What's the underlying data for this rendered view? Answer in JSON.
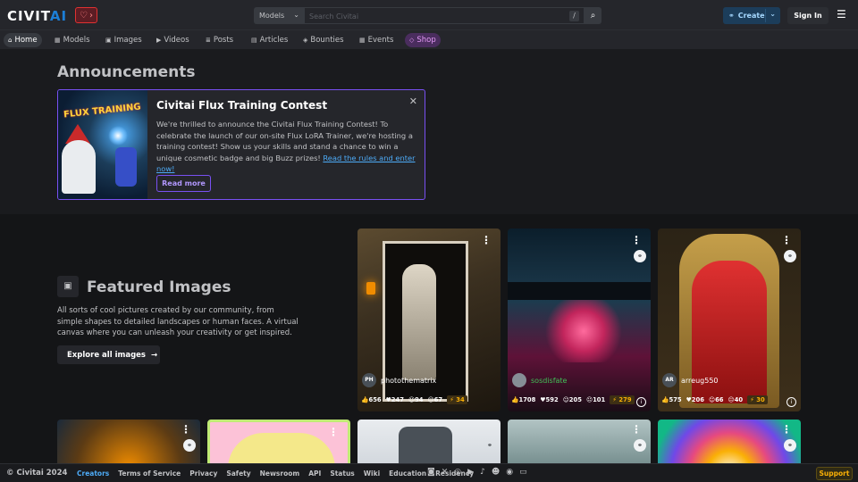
{
  "header": {
    "logo_main": "CIVIT",
    "logo_ai": "AI",
    "heart_chevron": "›",
    "search_type": "Models",
    "search_placeholder": "Search Civitai",
    "search_shortcut": "/",
    "create_label": "Create",
    "signin_label": "Sign In"
  },
  "nav": {
    "items": [
      {
        "label": "Home",
        "icon": "⌂"
      },
      {
        "label": "Models",
        "icon": "▦"
      },
      {
        "label": "Images",
        "icon": "▣"
      },
      {
        "label": "Videos",
        "icon": "▶"
      },
      {
        "label": "Posts",
        "icon": "≣"
      },
      {
        "label": "Articles",
        "icon": "▤"
      },
      {
        "label": "Bounties",
        "icon": "◈"
      },
      {
        "label": "Events",
        "icon": "▦"
      },
      {
        "label": "Shop",
        "icon": "◇"
      }
    ]
  },
  "announcements": {
    "title": "Announcements",
    "card": {
      "image_text": "FLUX TRAINING",
      "heading": "Civitai Flux Training Contest",
      "body": "We're thrilled to announce the Civitai Flux Training Contest! To celebrate the launch of our on-site Flux LoRA Trainer, we're hosting a training contest! Show us your skills and stand a chance to win a unique cosmetic badge and big Buzz prizes! ",
      "link": "Read the rules and enter now!",
      "button": "Read more"
    }
  },
  "featured": {
    "title": "Featured Images",
    "description": "All sorts of cool pictures created by our community, from simple shapes to detailed landscapes or human faces. A virtual canvas where you can unleash your creativity or get inspired.",
    "explore_label": "Explore all images",
    "cards": [
      {
        "initials": "PH",
        "user": "photothematrix",
        "stats": [
          "656",
          "247",
          "94",
          "67"
        ],
        "buzz": "34"
      },
      {
        "initials": "",
        "user": "sosdisfate",
        "stats": [
          "1708",
          "592",
          "205",
          "101"
        ],
        "buzz": "279"
      },
      {
        "initials": "AR",
        "user": "arreug550",
        "stats": [
          "575",
          "206",
          "66",
          "40"
        ],
        "buzz": "30"
      }
    ]
  },
  "footer": {
    "copyright": "© Civitai 2024",
    "links": [
      "Creators",
      "Terms of Service",
      "Privacy",
      "Safety",
      "Newsroom",
      "API",
      "Status",
      "Wiki",
      "Education",
      "Residency"
    ],
    "support": "Support"
  },
  "colors": {
    "accent": "#1c7ed6",
    "violet": "#7950f2",
    "buzz": "#fab005",
    "background": "#1a1b1e"
  }
}
